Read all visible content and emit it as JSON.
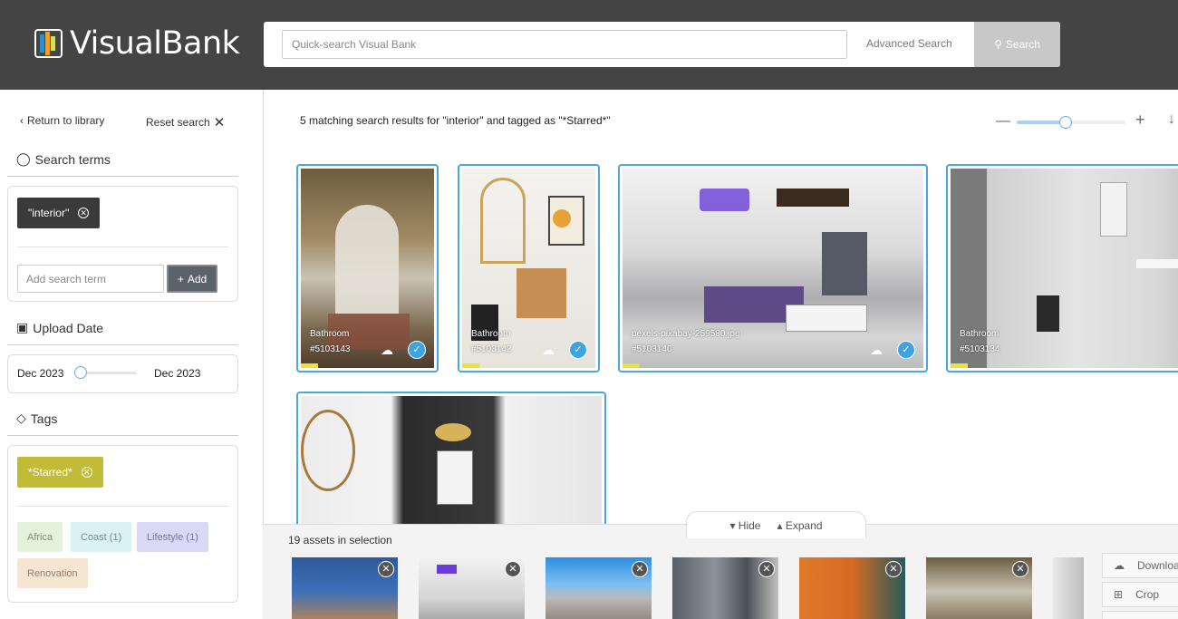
{
  "header": {
    "logo_text": "VisualBank",
    "search_placeholder": "Quick-search Visual Bank",
    "advanced_search": "Advanced Search",
    "search_button": "Search"
  },
  "sidebar": {
    "return_link": "Return to library",
    "reset_link": "Reset search",
    "search_terms_title": "Search terms",
    "active_term": "\"interior\"",
    "add_term_placeholder": "Add search term",
    "add_button": "Add",
    "upload_date_title": "Upload Date",
    "date_from": "Dec 2023",
    "date_to": "Dec 2023",
    "tags_title": "Tags",
    "active_tag": "*Starred*",
    "tags": [
      {
        "label": "Africa",
        "bg": "#e3f2da",
        "color": "#7a8f6f"
      },
      {
        "label": "Coast (1)",
        "bg": "#d9f3f3",
        "color": "#6d8e8e"
      },
      {
        "label": "Lifestyle (1)",
        "bg": "#d9d9f6",
        "color": "#75759a"
      },
      {
        "label": "Renovation",
        "bg": "#f5e6d2",
        "color": "#927d63"
      }
    ]
  },
  "main": {
    "results_text": "5 matching search results for \"interior\" and tagged as \"*Starred*\"",
    "zoom_level": 0.45,
    "cards": [
      {
        "title": "Bathroom",
        "id": "#5103143"
      },
      {
        "title": "Bathroom",
        "id": "#5103142"
      },
      {
        "title": "pexels-pixabay-259580.jpg",
        "id": "#5103140"
      },
      {
        "title": "Bathroom",
        "id": "#5103134"
      },
      {
        "title": "",
        "id": ""
      }
    ]
  },
  "tray": {
    "hide_label": "Hide",
    "expand_label": "Expand",
    "count_text": "19 assets in selection",
    "actions": {
      "download": "Download",
      "crop": "Crop"
    }
  }
}
